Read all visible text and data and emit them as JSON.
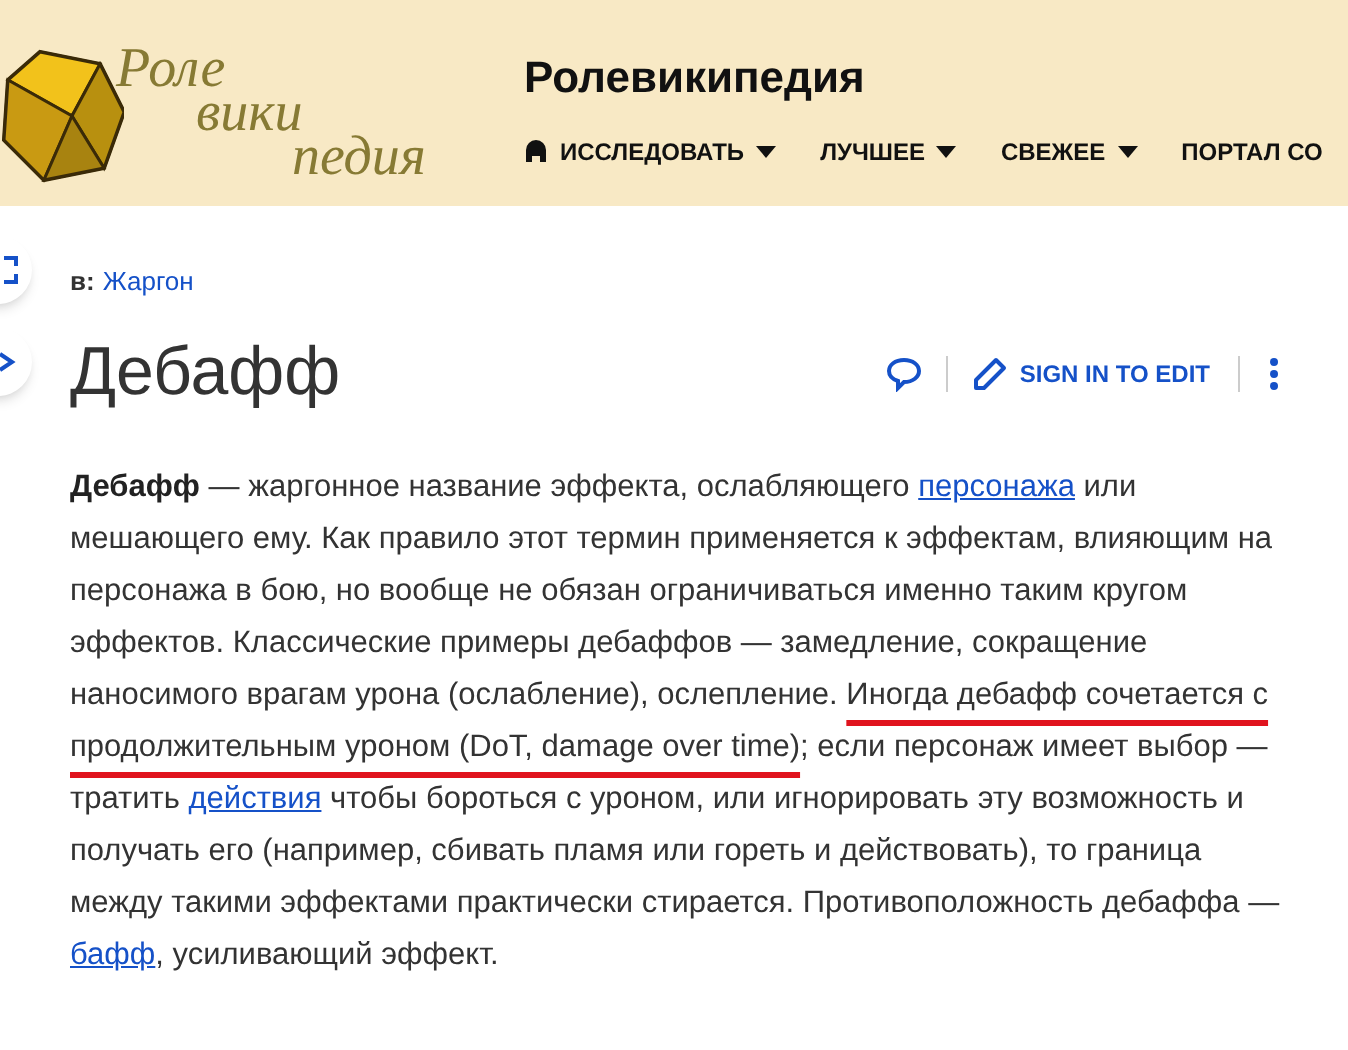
{
  "header": {
    "logo_lines": [
      "Роле",
      "вики",
      "педия"
    ],
    "site_title": "Ролевикипедия",
    "nav": [
      {
        "label": "ИССЛЕДОВАТЬ",
        "kind": "explore"
      },
      {
        "label": "ЛУЧШЕЕ",
        "kind": "menu"
      },
      {
        "label": "СВЕЖЕЕ",
        "kind": "menu"
      },
      {
        "label": "ПОРТАЛ СО",
        "kind": "plain"
      }
    ]
  },
  "breadcrumb": {
    "prefix": "в:",
    "link": "Жаргон"
  },
  "page_title": "Дебафф",
  "actions": {
    "edit_label": "SIGN IN TO EDIT"
  },
  "paragraph": [
    {
      "kind": "bold",
      "text": "Дебафф"
    },
    {
      "kind": "text",
      "text": " — жаргонное название эффекта, ослабляющего "
    },
    {
      "kind": "link",
      "text": "персонажа"
    },
    {
      "kind": "text",
      "text": " или мешающего ему. Как правило этот термин применяется к эффектам, влияющим на персонажа в бою, но вообще не обязан ограничиваться именно таким кругом эффектов. Классические примеры дебаффов — замедление, сокращение наносимого врагам урона (ослабление), ослепление. "
    },
    {
      "kind": "marked",
      "text": "Иногда дебафф сочетается с продолжительным уроном (DoT, damage over time)"
    },
    {
      "kind": "text",
      "text": "; если персонаж имеет выбор — тратить "
    },
    {
      "kind": "link",
      "text": "действия"
    },
    {
      "kind": "text",
      "text": " чтобы бороться с уроном, или игнорировать эту возможность и получать его (например, сбивать пламя или гореть и действовать), то граница между такими эффектами практически стирается. Противоположность дебаффа — "
    },
    {
      "kind": "link",
      "text": "бафф"
    },
    {
      "kind": "text",
      "text": ", усиливающий эффект."
    }
  ]
}
